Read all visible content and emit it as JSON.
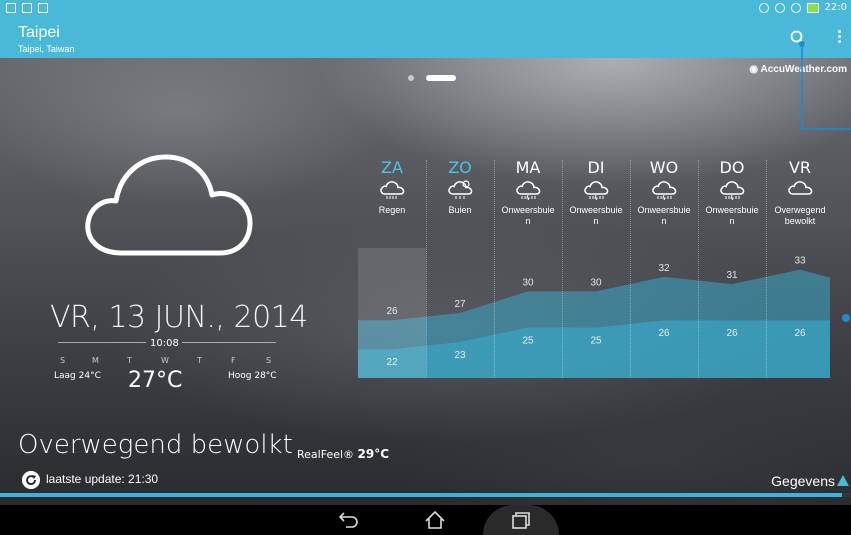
{
  "status": {
    "time": "22:0"
  },
  "location": {
    "city": "Taipei",
    "region": "Taipei, Taiwan"
  },
  "provider": {
    "name": "AccuWeather.com"
  },
  "today": {
    "date": "VR, 13 JUN., 2014",
    "time": "10:08",
    "weekdays": [
      "S",
      "M",
      "T",
      "W",
      "T",
      "F",
      "S"
    ],
    "low": "Laag 24°C",
    "current_temp": "27°C",
    "high": "Hoog 28°C",
    "condition": "Overwegend bewolkt",
    "realfeel_label": "RealFeel®",
    "realfeel_value": "29°C",
    "last_update": "laatste update: 21:30",
    "details_label": "Gegevens"
  },
  "forecast": {
    "days": [
      {
        "name": "ZA",
        "icon": "rain-icon",
        "desc": "Regen",
        "high": 26,
        "low": 22,
        "highlight": true
      },
      {
        "name": "ZO",
        "icon": "showers-sun-icon",
        "desc": "Buien",
        "high": 27,
        "low": 23,
        "highlight": true
      },
      {
        "name": "MA",
        "icon": "thunderstorm-icon",
        "desc": "Onweersbuie\nn",
        "high": 30,
        "low": 25,
        "highlight": false
      },
      {
        "name": "DI",
        "icon": "thunderstorm-icon",
        "desc": "Onweersbuie\nn",
        "high": 30,
        "low": 25,
        "highlight": false
      },
      {
        "name": "WO",
        "icon": "thunderstorm-icon",
        "desc": "Onweersbuie\nn",
        "high": 32,
        "low": 26,
        "highlight": false
      },
      {
        "name": "DO",
        "icon": "thunderstorm-icon",
        "desc": "Onweersbuie\nn",
        "high": 31,
        "low": 26,
        "highlight": false
      },
      {
        "name": "VR",
        "icon": "cloud-icon",
        "desc": "Overwegend\nbewolkt",
        "high": 33,
        "low": 26,
        "highlight": false
      }
    ]
  },
  "colors": {
    "accent": "#4ab8d8",
    "highlight_day": "#4cc3ea",
    "band": "#3aa8c8"
  },
  "update_progress": 0.99
}
